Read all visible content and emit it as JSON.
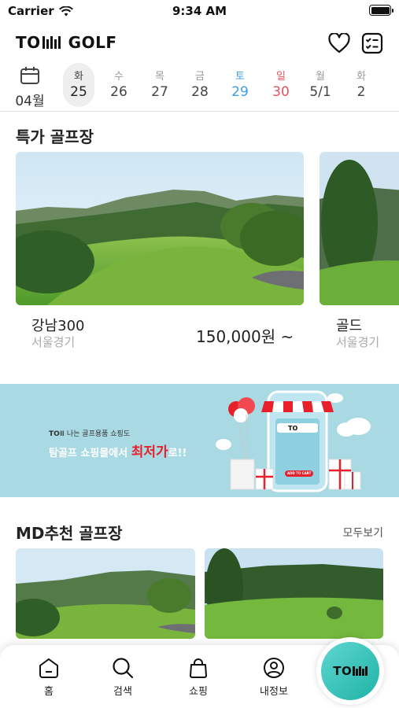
{
  "status_bar": {
    "carrier": "Carrier",
    "time": "9:34 AM"
  },
  "header": {
    "logo_prefix": "TO",
    "logo_suffix": "GOLF"
  },
  "dates": {
    "month": "04월",
    "days": [
      {
        "weekday": "화",
        "date": "25",
        "kind": "selected"
      },
      {
        "weekday": "수",
        "date": "26",
        "kind": "normal"
      },
      {
        "weekday": "목",
        "date": "27",
        "kind": "normal"
      },
      {
        "weekday": "금",
        "date": "28",
        "kind": "normal"
      },
      {
        "weekday": "토",
        "date": "29",
        "kind": "sat"
      },
      {
        "weekday": "일",
        "date": "30",
        "kind": "sun"
      },
      {
        "weekday": "월",
        "date": "5/1",
        "kind": "normal"
      },
      {
        "weekday": "화",
        "date": "2",
        "kind": "normal"
      }
    ]
  },
  "special": {
    "title": "특가 골프장",
    "courses": [
      {
        "name": "강남300",
        "region": "서울경기",
        "price": "150,000원 ~"
      },
      {
        "name": "골드",
        "region": "서울경기"
      }
    ]
  },
  "banner": {
    "line1_brand": "TO",
    "line1_text": "나는 골프용품 쇼핑도",
    "line2_pre": "탐골프 쇼핑몰에서 ",
    "line2_highlight": "최저가",
    "line2_post": "로!!",
    "phone_label": "TO",
    "cart_label": "ADD TO CART"
  },
  "md": {
    "title": "MD추천 골프장",
    "see_all": "모두보기"
  },
  "tabs": [
    {
      "label": "홈",
      "icon": "home-icon"
    },
    {
      "label": "검색",
      "icon": "search-icon"
    },
    {
      "label": "쇼핑",
      "icon": "shopping-bag-icon"
    },
    {
      "label": "내정보",
      "icon": "user-icon"
    }
  ],
  "fab_label": "TO",
  "colors": {
    "saturday": "#3aa0e6",
    "sunday": "#e6505a",
    "accent": "#1fb3a7",
    "banner_bg": "#a9d9e3"
  }
}
